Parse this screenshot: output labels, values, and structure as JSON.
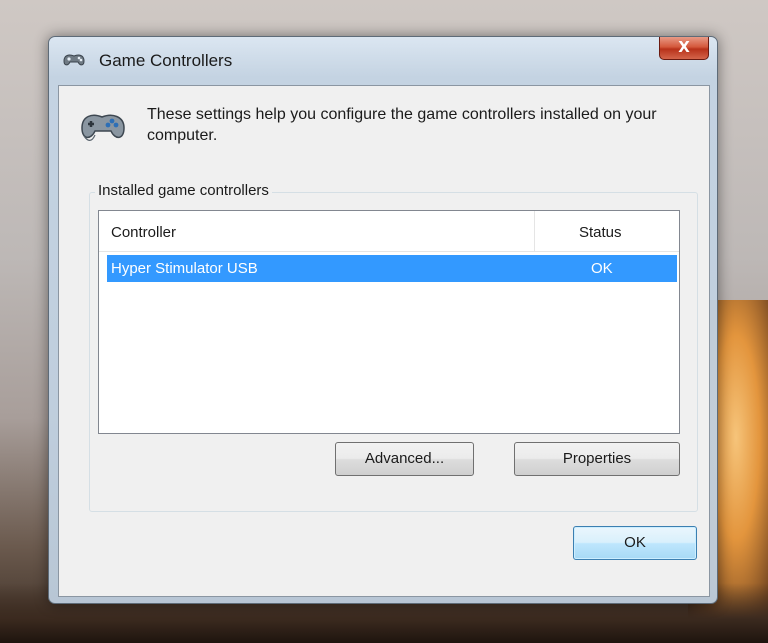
{
  "window": {
    "title": "Game Controllers",
    "close_label": "X"
  },
  "header": {
    "description": "These settings help you configure the game controllers installed on your computer."
  },
  "group": {
    "label": "Installed game controllers"
  },
  "list": {
    "columns": [
      "Controller",
      "Status"
    ],
    "rows": [
      {
        "controller": "Hyper Stimulator USB",
        "status": "OK",
        "selected": true
      }
    ]
  },
  "buttons": {
    "advanced": "Advanced...",
    "properties": "Properties",
    "ok": "OK"
  },
  "colors": {
    "selection": "#3399ff",
    "close_button": "#c8462c",
    "ok_border": "#3c7fb1"
  },
  "icons": {
    "title": "gamepad-icon",
    "header": "gamepad-icon"
  }
}
